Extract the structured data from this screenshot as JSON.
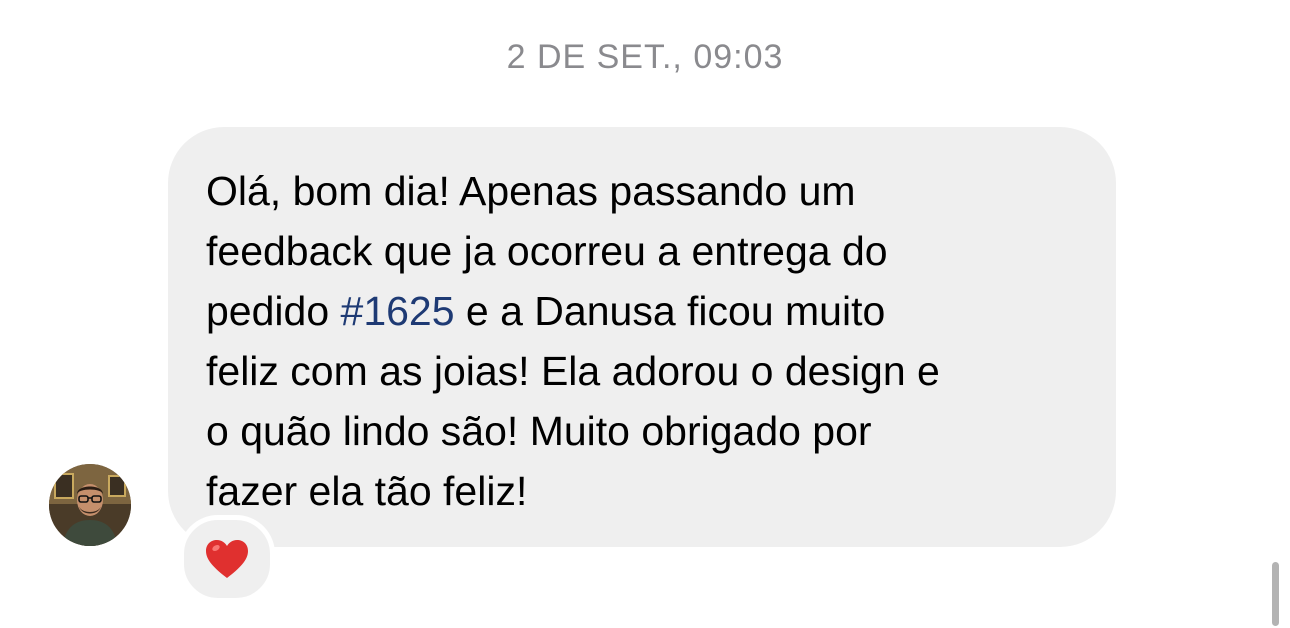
{
  "conversation": {
    "timestamp": "2 DE SET., 09:03"
  },
  "message": {
    "lines": [
      [
        "Olá, bom dia! Apenas passando um"
      ],
      [
        "feedback que ja ocorreu a entrega do"
      ],
      [
        "pedido ",
        "#1625",
        " e a Danusa ficou muito"
      ],
      [
        "feliz com as joias! Ela adorou o design e"
      ],
      [
        "o quão lindo são! Muito obrigado por"
      ],
      [
        "fazer ela tão feliz!"
      ]
    ],
    "reaction": "heart-icon"
  },
  "colors": {
    "bubble": "#efefef",
    "link": "#1e3a74",
    "timestamp": "#8a8a8e",
    "heart": "#e0302f"
  }
}
